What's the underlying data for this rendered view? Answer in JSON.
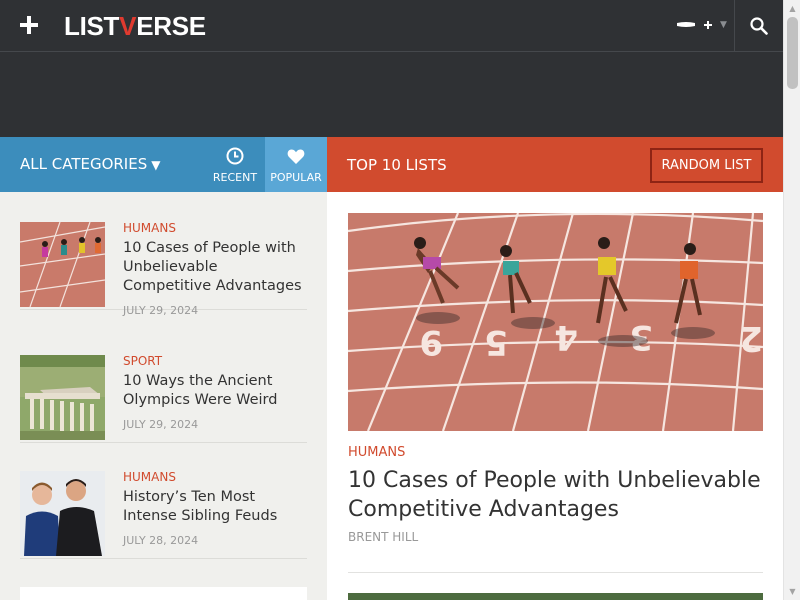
{
  "header": {
    "logo_text_1": "LIST",
    "logo_text_v": "V",
    "logo_text_2": "ERSE",
    "menu_icon": "plus-icon",
    "language_icon": "flag-icon",
    "search_icon": "search-icon"
  },
  "category_bar": {
    "all_categories": "ALL CATEGORIES",
    "recent_label": "RECENT",
    "popular_label": "POPULAR"
  },
  "top10_bar": {
    "title": "TOP 10 LISTS",
    "random_button": "RANDOM LIST"
  },
  "sidebar": {
    "items": [
      {
        "category": "HUMANS",
        "title": "10 Cases of People with Unbelievable Competitive Advantages",
        "date": "JULY 29, 2024"
      },
      {
        "category": "SPORT",
        "title": "10 Ways the Ancient Olympics Were Weird",
        "date": "JULY 29, 2024"
      },
      {
        "category": "HUMANS",
        "title": "History’s Ten Most Intense Sibling Feuds",
        "date": "JULY 28, 2024"
      }
    ]
  },
  "feature": {
    "category": "HUMANS",
    "title": "10 Cases of People with Unbelievable Competitive Advantages",
    "author": "BRENT HILL"
  },
  "colors": {
    "nav_bg": "#2f3134",
    "category_blue": "#3c8dbc",
    "popular_blue": "#5aa7d6",
    "top10_red": "#d14b2e",
    "accent_red": "#d14b2e"
  }
}
